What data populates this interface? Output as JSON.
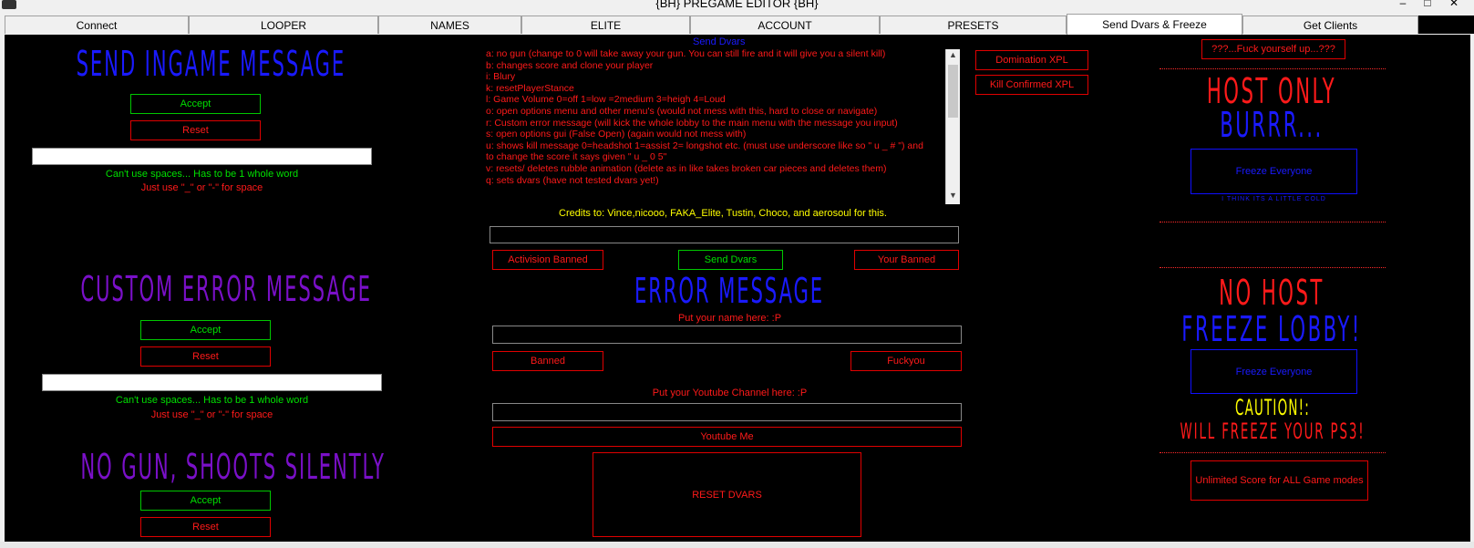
{
  "window": {
    "title": "{BH} PREGAME EDITOR {BH}"
  },
  "tabs": [
    {
      "label": "Connect"
    },
    {
      "label": "LOOPER"
    },
    {
      "label": "NAMES"
    },
    {
      "label": "ELITE"
    },
    {
      "label": "ACCOUNT"
    },
    {
      "label": "PRESETS"
    },
    {
      "label": "Send Dvars & Freeze"
    },
    {
      "label": "Get Clients"
    }
  ],
  "left": {
    "ingame": {
      "title": "SEND INGAME MESSAGE",
      "accept": "Accept",
      "reset": "Reset",
      "hint1": "Can't use spaces... Has to be 1 whole word",
      "hint2": "Just use \"_\" or \"-\" for space"
    },
    "error": {
      "title": "CUSTOM ERROR MESSAGE",
      "accept": "Accept",
      "reset": "Reset",
      "hint1": "Can't use spaces... Has to be 1 whole word",
      "hint2": "Just use \"_\" or \"-\" for space"
    },
    "nogun": {
      "title": "NO GUN, SHOOTS SILENTLY",
      "accept": "Accept",
      "reset": "Reset"
    }
  },
  "center": {
    "dvars_header": "Send Dvars",
    "dvar_lines": [
      "a: no gun (change to 0 will take away your gun. You can still fire and it will give you a silent kill)",
      "b: changes score and clone your player",
      "i: Blury",
      "k: resetPlayerStance",
      "l: Game Volume 0=off 1=low =2medium 3=heigh 4=Loud",
      "o: open options menu and other menu's (would not mess with this, hard to close or navigate)",
      "r: Custom error message (will kick the whole lobby to the main menu with the message you input)",
      "s: open options gui (False Open) (again would not mess with)",
      "u: shows kill message 0=headshot 1=assist 2= longshot etc. (must use underscore like so \" u _ # \") and",
      "to change the score it says given \" u _ 0 5\"",
      "v: resets/ deletes rubble animation (delete as in like takes broken car pieces and deletes them)",
      "q: sets dvars (have not tested dvars yet!)"
    ],
    "credits": "Credits to: Vince,nicooo, FAKA_Elite, Tustin, Choco, and aerosoul for this.",
    "activision_banned": "Activision Banned",
    "send_dvars": "Send Dvars",
    "your_banned": "Your Banned",
    "error_title": "ERROR MESSAGE",
    "name_label": "Put your name here: :P",
    "banned": "Banned",
    "fuckyou": "Fuckyou",
    "youtube_label": "Put your Youtube Channel here: :P",
    "youtube_me": "Youtube Me",
    "reset_dvars": "RESET DVARS"
  },
  "xpl": {
    "domination": "Domination XPL",
    "kill_confirmed": "Kill Confirmed XPL"
  },
  "right": {
    "top_button": "???...Fuck yourself up...???",
    "host_only": "HOST ONLY",
    "burrr": "BURRR...",
    "freeze1": "Freeze Everyone",
    "tiny_note": "I THINK ITS A LITTLE COLD",
    "no_host": "NO HOST",
    "freeze_lobby": "FREEZE LOBBY!",
    "freeze2": "Freeze Everyone",
    "caution": "CAUTION!:",
    "will_freeze": "WILL FREEZE YOUR PS3!",
    "unlimited": "Unlimited Score for ALL Game modes"
  },
  "colors": {
    "red": "#ff1a1a",
    "green": "#00e000",
    "blue": "#1a1aff",
    "purple": "#7a10c8",
    "yellow": "#ffff00"
  }
}
